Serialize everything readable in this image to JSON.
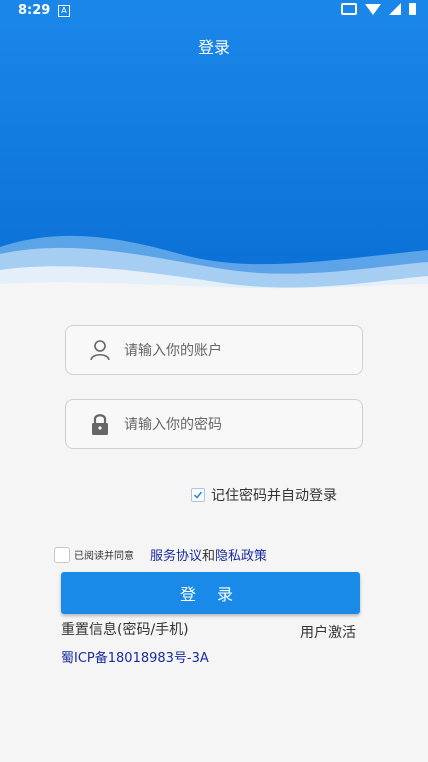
{
  "status_bar": {
    "time": "8:29",
    "notification_letter": "A"
  },
  "header": {
    "title": "登录"
  },
  "account_field": {
    "placeholder": "请输入你的账户",
    "value": ""
  },
  "password_field": {
    "placeholder": "请输入你的密码",
    "value": ""
  },
  "remember": {
    "label": "记住密码并自动登录",
    "checked": true
  },
  "agreement": {
    "prefix": "已阅读并同意",
    "service_link": "服务协议",
    "and": "和",
    "privacy_link": "隐私政策",
    "checked": false
  },
  "login_button": {
    "label": "登 录"
  },
  "links": {
    "reset": "重置信息(密码/手机)",
    "activate": "用户激活"
  },
  "footer": {
    "icp": "蜀ICP备18018983号-3A"
  },
  "colors": {
    "primary": "#1a86e8",
    "link": "#1a2ba0",
    "background": "#f5f5f5"
  }
}
